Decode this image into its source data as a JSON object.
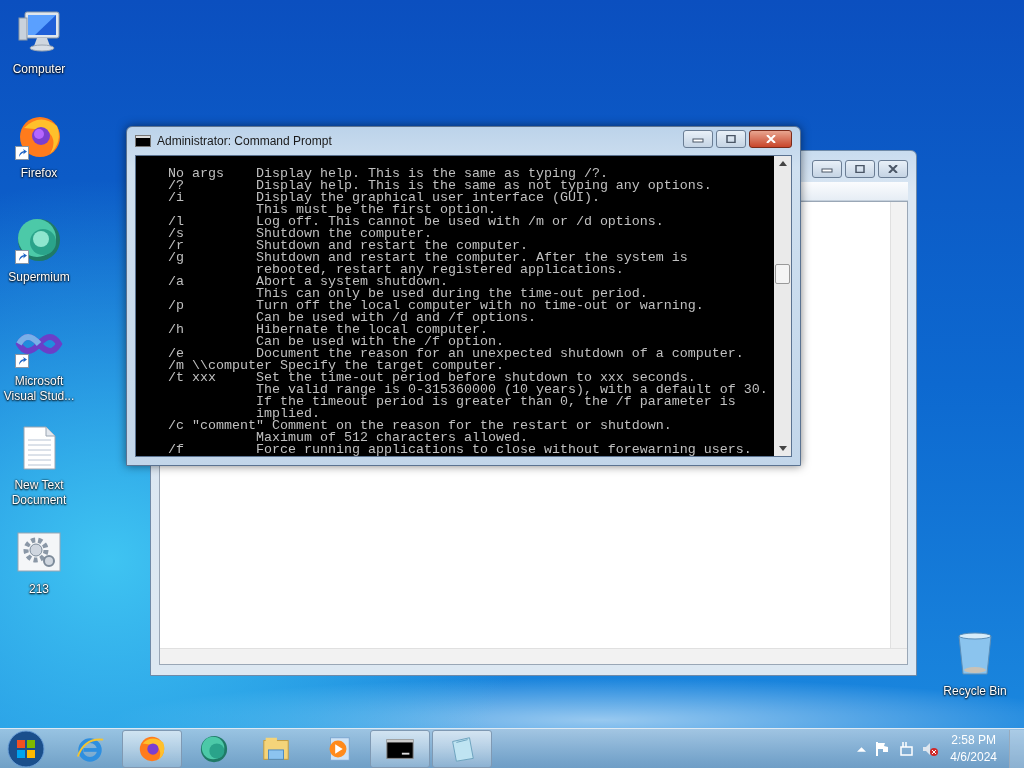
{
  "desktop_icons": [
    {
      "label": "Computer",
      "kind": "computer",
      "shortcut": false
    },
    {
      "label": "Firefox",
      "kind": "firefox",
      "shortcut": true
    },
    {
      "label": "Supermium",
      "kind": "supermium",
      "shortcut": true
    },
    {
      "label": "Microsoft Visual Stud...",
      "kind": "visualstudio",
      "shortcut": true
    },
    {
      "label": "New Text Document",
      "kind": "textfile",
      "shortcut": false
    },
    {
      "label": "213",
      "kind": "settingsfile",
      "shortcut": false
    }
  ],
  "recycle_bin": {
    "label": "Recycle Bin"
  },
  "back_window": {
    "kind": "editor"
  },
  "console_window": {
    "title": "Administrator: Command Prompt",
    "lines": [
      {
        "option": "No args",
        "text": "Display help. This is the same as typing /?."
      },
      {
        "option": "/?",
        "text": "Display help. This is the same as not typing any options."
      },
      {
        "option": "/i",
        "text": "Display the graphical user interface (GUI)."
      },
      {
        "text": "This must be the first option."
      },
      {
        "option": "/l",
        "text": "Log off. This cannot be used with /m or /d options."
      },
      {
        "option": "/s",
        "text": "Shutdown the computer."
      },
      {
        "option": "/r",
        "text": "Shutdown and restart the computer."
      },
      {
        "option": "/g",
        "text": "Shutdown and restart the computer. After the system is"
      },
      {
        "text": "rebooted, restart any registered applications."
      },
      {
        "option": "/a",
        "text": "Abort a system shutdown."
      },
      {
        "text": "This can only be used during the time-out period."
      },
      {
        "option": "/p",
        "text": "Turn off the local computer with no time-out or warning."
      },
      {
        "text": "Can be used with /d and /f options."
      },
      {
        "option": "/h",
        "text": "Hibernate the local computer."
      },
      {
        "text": "Can be used with the /f option."
      },
      {
        "option": "/e",
        "text": "Document the reason for an unexpected shutdown of a computer."
      },
      {
        "option": "/m \\\\computer",
        "text": "Specify the target computer."
      },
      {
        "option": "/t xxx",
        "text": "Set the time-out period before shutdown to xxx seconds."
      },
      {
        "text": "The valid range is 0-315360000 (10 years), with a default of 30."
      },
      {
        "text": "If the timeout period is greater than 0, the /f parameter is"
      },
      {
        "text": "implied."
      },
      {
        "option": "/c \"comment\"",
        "text": "Comment on the reason for the restart or shutdown."
      },
      {
        "text": "Maximum of 512 characters allowed."
      },
      {
        "option": "/f",
        "text": "Force running applications to close without forewarning users."
      }
    ]
  },
  "taskbar": {
    "items": [
      {
        "kind": "ie",
        "running": false
      },
      {
        "kind": "firefox",
        "running": true
      },
      {
        "kind": "supermium",
        "running": false
      },
      {
        "kind": "explorer",
        "running": false
      },
      {
        "kind": "mediaplayer",
        "running": false
      },
      {
        "kind": "console",
        "running": true
      },
      {
        "kind": "notepad",
        "running": true
      }
    ],
    "clock": {
      "time": "2:58 PM",
      "date": "4/6/2024"
    }
  }
}
